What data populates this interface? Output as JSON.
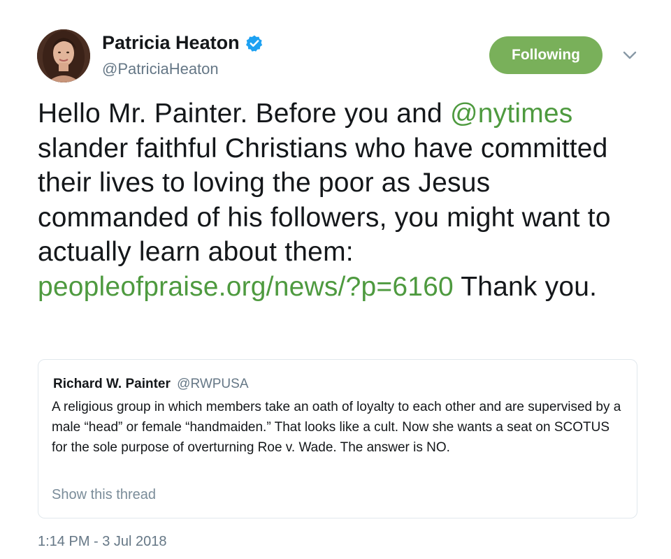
{
  "author": {
    "name": "Patricia Heaton",
    "handle": "@PatriciaHeaton",
    "verified_icon": "verified-badge-icon",
    "avatar_icon": "profile-photo"
  },
  "follow_button": {
    "label": "Following",
    "color": "#79b05a"
  },
  "menu": {
    "icon": "chevron-down-icon"
  },
  "tweet": {
    "text_1": "Hello Mr. Painter.  Before you and ",
    "mention": "@nytimes",
    "text_2": " slander faithful Christians who have committed their lives to loving the poor as Jesus commanded of his followers, you might want to actually learn about them: ",
    "link": "peopleofpraise.org/news/?p=6160",
    "text_3": " Thank you.",
    "link_color": "#4e9a3f"
  },
  "quoted_tweet": {
    "name": "Richard W. Painter",
    "handle": "@RWPUSA",
    "text": "A religious group in which members take an oath of loyalty to each other and are supervised by a male “head” or female “handmaiden.”  That looks like a cult. Now she wants a seat on SCOTUS for the sole purpose of overturning Roe v. Wade. The answer is NO.",
    "show_thread": "Show this thread"
  },
  "timestamp": "1:14 PM - 3 Jul 2018"
}
